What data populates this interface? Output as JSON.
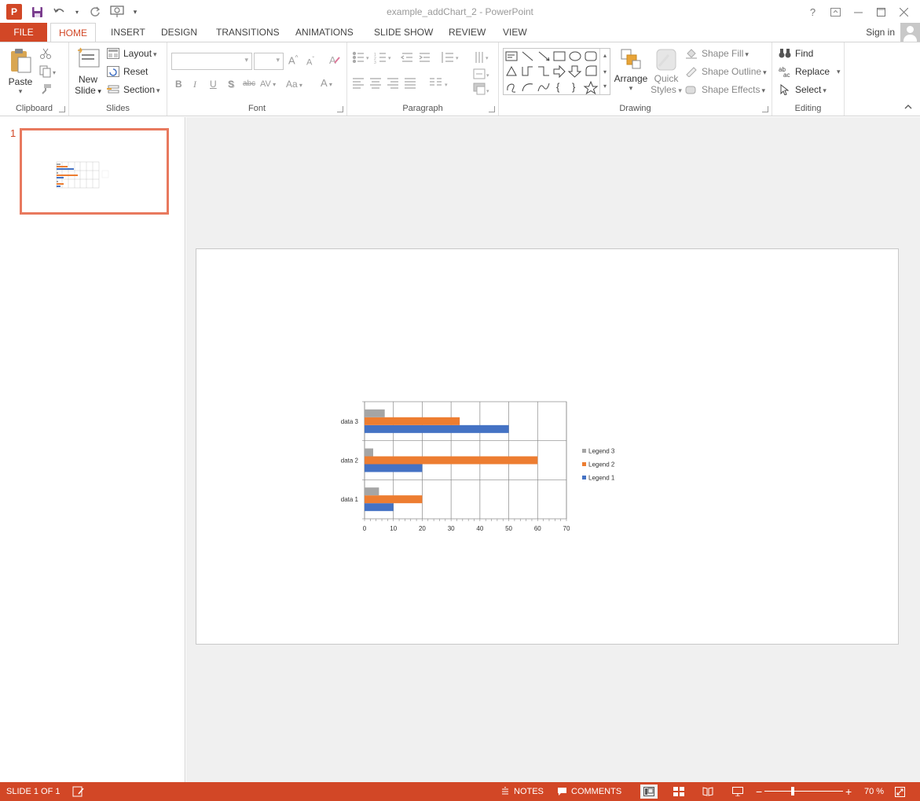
{
  "window": {
    "title": "example_addChart_2 - PowerPoint",
    "logo": "P"
  },
  "qat": {
    "icons": [
      "powerpoint-logo-icon",
      "save-icon",
      "undo-icon",
      "redo-icon",
      "start-from-beginning-icon",
      "customize-qat-icon"
    ]
  },
  "window_controls": {
    "help": "?",
    "ribbon_display": "ribbon-display-options-icon",
    "minimize": "minimize-icon",
    "maximize": "maximize-icon",
    "close": "close-icon"
  },
  "tabs": {
    "file": "FILE",
    "home": "HOME",
    "insert": "INSERT",
    "design": "DESIGN",
    "transitions": "TRANSITIONS",
    "animations": "ANIMATIONS",
    "slideshow": "SLIDE SHOW",
    "review": "REVIEW",
    "view": "VIEW",
    "active": "HOME"
  },
  "account": {
    "sign_in": "Sign in"
  },
  "ribbon": {
    "clipboard": {
      "label": "Clipboard",
      "paste": "Paste"
    },
    "slides": {
      "label": "Slides",
      "new_slide_line1": "New",
      "new_slide_line2": "Slide",
      "layout": "Layout",
      "reset": "Reset",
      "section": "Section"
    },
    "font": {
      "label": "Font",
      "bold": "B",
      "italic": "I",
      "underline": "U",
      "shadow": "S",
      "strikethrough": "abc",
      "spacing": "AV",
      "case": "Aa",
      "color": "A",
      "grow": "A",
      "shrink": "A"
    },
    "paragraph": {
      "label": "Paragraph"
    },
    "drawing": {
      "label": "Drawing",
      "arrange": "Arrange",
      "quick_styles_line1": "Quick",
      "quick_styles_line2": "Styles",
      "shape_fill": "Shape Fill",
      "shape_outline": "Shape Outline",
      "shape_effects": "Shape Effects"
    },
    "editing": {
      "label": "Editing",
      "find": "Find",
      "replace": "Replace",
      "select": "Select"
    }
  },
  "slide_panel": {
    "slide_number": "1"
  },
  "status": {
    "slide_info": "SLIDE 1 OF 1",
    "notes": "NOTES",
    "comments": "COMMENTS",
    "zoom": "70 %"
  },
  "colors": {
    "accent": "#d24726",
    "series1": "#4472c4",
    "series2": "#ed7d31",
    "series3": "#a5a5a5"
  },
  "chart_data": {
    "type": "bar",
    "orientation": "horizontal",
    "categories": [
      "data 1",
      "data 2",
      "data 3"
    ],
    "series": [
      {
        "name": "Legend 1",
        "values": [
          10,
          20,
          50
        ],
        "color": "#4472c4"
      },
      {
        "name": "Legend 2",
        "values": [
          20,
          60,
          33
        ],
        "color": "#ed7d31"
      },
      {
        "name": "Legend 3",
        "values": [
          5,
          3,
          7
        ],
        "color": "#a5a5a5"
      }
    ],
    "xlim": [
      0,
      70
    ],
    "x_ticks": [
      "0",
      "10",
      "20",
      "30",
      "40",
      "50",
      "60",
      "70"
    ],
    "grid": true,
    "legend_position": "right",
    "legend_order": [
      "Legend 3",
      "Legend 2",
      "Legend 1"
    ]
  }
}
